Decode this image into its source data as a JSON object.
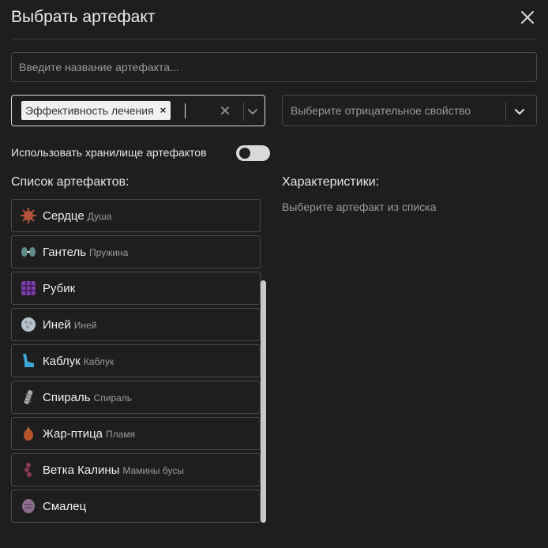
{
  "dialog": {
    "title": "Выбрать артефакт"
  },
  "search": {
    "placeholder": "Введите название артефакта...",
    "value": ""
  },
  "positive_filter": {
    "selected": [
      "Эффективность лечения"
    ]
  },
  "negative_filter": {
    "placeholder": "Выберите отрицательное свойство"
  },
  "storage_toggle": {
    "label": "Использовать хранилище артефактов",
    "on": false
  },
  "artifact_list": {
    "title": "Список артефактов:",
    "items": [
      {
        "name": "Сердце",
        "alt": "Душа",
        "icon": "heart-artifact-icon",
        "color": "#b5533a"
      },
      {
        "name": "Гантель",
        "alt": "Пружина",
        "icon": "dumbbell-artifact-icon",
        "color": "#5f8e88"
      },
      {
        "name": "Рубик",
        "alt": "",
        "icon": "cube-artifact-icon",
        "color": "#7a3fa8"
      },
      {
        "name": "Иней",
        "alt": "Иней",
        "icon": "frost-artifact-icon",
        "color": "#b9c2c8"
      },
      {
        "name": "Каблук",
        "alt": "Каблук",
        "icon": "heel-artifact-icon",
        "color": "#3ea6d6"
      },
      {
        "name": "Спираль",
        "alt": "Спираль",
        "icon": "spiral-artifact-icon",
        "color": "#a9a9a9"
      },
      {
        "name": "Жар-птица",
        "alt": "Пламя",
        "icon": "firebird-artifact-icon",
        "color": "#b8542b"
      },
      {
        "name": "Ветка Калины",
        "alt": "Мамины бусы",
        "icon": "viburnum-artifact-icon",
        "color": "#8e3a55"
      },
      {
        "name": "Смалец",
        "alt": "",
        "icon": "lard-artifact-icon",
        "color": "#8c6d8c"
      }
    ]
  },
  "characteristics": {
    "title": "Характеристики:",
    "hint": "Выберите артефакт из списка"
  }
}
